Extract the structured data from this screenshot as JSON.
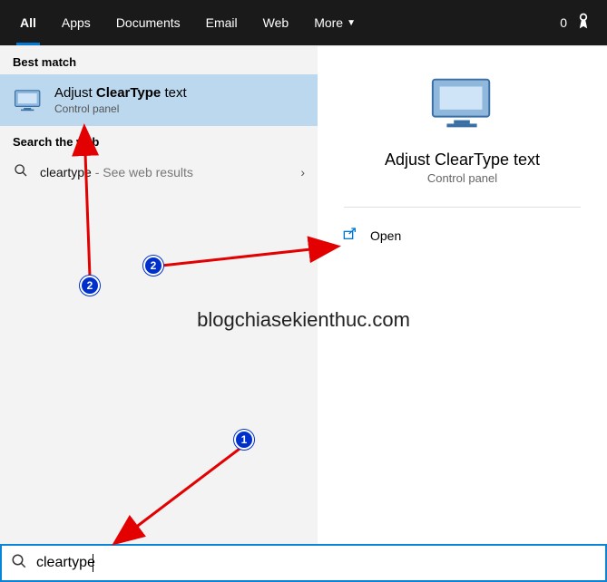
{
  "tabs": {
    "all": "All",
    "apps": "Apps",
    "documents": "Documents",
    "email": "Email",
    "web": "Web",
    "more": "More"
  },
  "top_right": {
    "count": "0"
  },
  "left": {
    "best_match_label": "Best match",
    "best_match": {
      "title_pre": "Adjust ",
      "title_bold": "ClearType",
      "title_post": " text",
      "subtitle": "Control panel"
    },
    "search_web_label": "Search the web",
    "web_result": {
      "term": "cleartype",
      "hint": " - See web results"
    }
  },
  "right": {
    "title": "Adjust ClearType text",
    "subtitle": "Control panel",
    "open": "Open"
  },
  "watermark": "blogchiasekienthuc.com",
  "search": {
    "value": "cleartype",
    "placeholder": ""
  },
  "annotations": {
    "badge1": "1",
    "badge2a": "2",
    "badge2b": "2"
  }
}
